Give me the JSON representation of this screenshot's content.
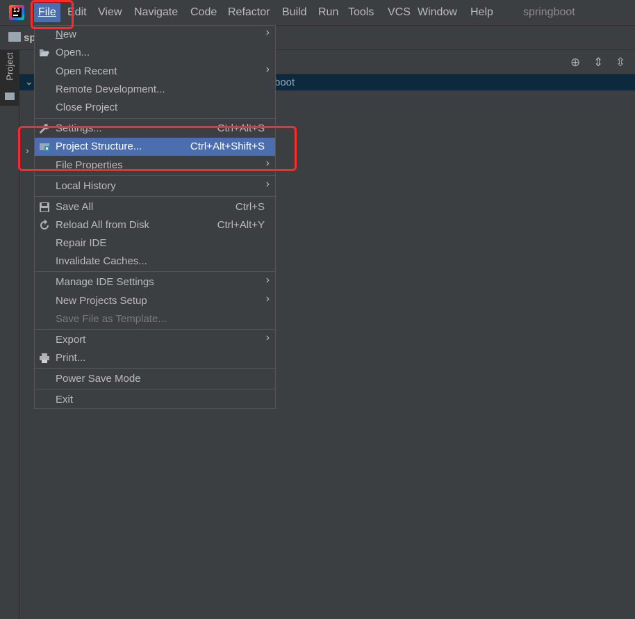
{
  "menubar": {
    "items": [
      {
        "label": "File",
        "mnemonic_index": 0
      },
      {
        "label": "Edit",
        "mnemonic_index": 0
      },
      {
        "label": "View",
        "mnemonic_index": 0
      },
      {
        "label": "Navigate",
        "mnemonic_index": 0
      },
      {
        "label": "Code",
        "mnemonic_index": 0
      },
      {
        "label": "Refactor",
        "mnemonic_index": 0
      },
      {
        "label": "Build",
        "mnemonic_index": 0
      },
      {
        "label": "Run",
        "mnemonic_index": 1
      },
      {
        "label": "Tools",
        "mnemonic_index": 0
      },
      {
        "label": "VCS",
        "mnemonic_index": 2
      },
      {
        "label": "Window",
        "mnemonic_index": 0
      },
      {
        "label": "Help",
        "mnemonic_index": 0
      }
    ],
    "project_name": "springboot"
  },
  "navbar": {
    "breadcrumb": "sp"
  },
  "side_panel": {
    "tab_label": "Project"
  },
  "tree": {
    "selected_partial": "boot"
  },
  "file_menu": {
    "items": [
      {
        "label": "New",
        "shortcut": "",
        "submenu": true
      },
      {
        "label": "Open...",
        "shortcut": "",
        "submenu": false,
        "icon": "folder-open-icon"
      },
      {
        "label": "Open Recent",
        "shortcut": "",
        "submenu": true
      },
      {
        "label": "Remote Development...",
        "shortcut": "",
        "submenu": false
      },
      {
        "label": "Close Project",
        "shortcut": "",
        "submenu": false
      },
      {
        "label": "Settings...",
        "shortcut": "Ctrl+Alt+S",
        "submenu": false,
        "icon": "wrench-icon"
      },
      {
        "label": "Project Structure...",
        "shortcut": "Ctrl+Alt+Shift+S",
        "submenu": false,
        "icon": "project-structure-icon",
        "selected": true
      },
      {
        "label": "File Properties",
        "shortcut": "",
        "submenu": true
      },
      {
        "label": "Local History",
        "shortcut": "",
        "submenu": true
      },
      {
        "label": "Save All",
        "shortcut": "Ctrl+S",
        "submenu": false,
        "icon": "save-icon"
      },
      {
        "label": "Reload All from Disk",
        "shortcut": "Ctrl+Alt+Y",
        "submenu": false,
        "icon": "reload-icon"
      },
      {
        "label": "Repair IDE",
        "shortcut": "",
        "submenu": false
      },
      {
        "label": "Invalidate Caches...",
        "shortcut": "",
        "submenu": false
      },
      {
        "label": "Manage IDE Settings",
        "shortcut": "",
        "submenu": true
      },
      {
        "label": "New Projects Setup",
        "shortcut": "",
        "submenu": true
      },
      {
        "label": "Save File as Template...",
        "shortcut": "",
        "submenu": false,
        "disabled": true
      },
      {
        "label": "Export",
        "shortcut": "",
        "submenu": true
      },
      {
        "label": "Print...",
        "shortcut": "",
        "submenu": false,
        "icon": "print-icon"
      },
      {
        "label": "Power Save Mode",
        "shortcut": "",
        "submenu": false
      },
      {
        "label": "Exit",
        "shortcut": "",
        "submenu": false
      }
    ]
  },
  "colors": {
    "accent": "#4b6eaf",
    "highlight_box": "#ff2a2a",
    "background": "#3c3f41",
    "selected_row": "#0d293e"
  }
}
